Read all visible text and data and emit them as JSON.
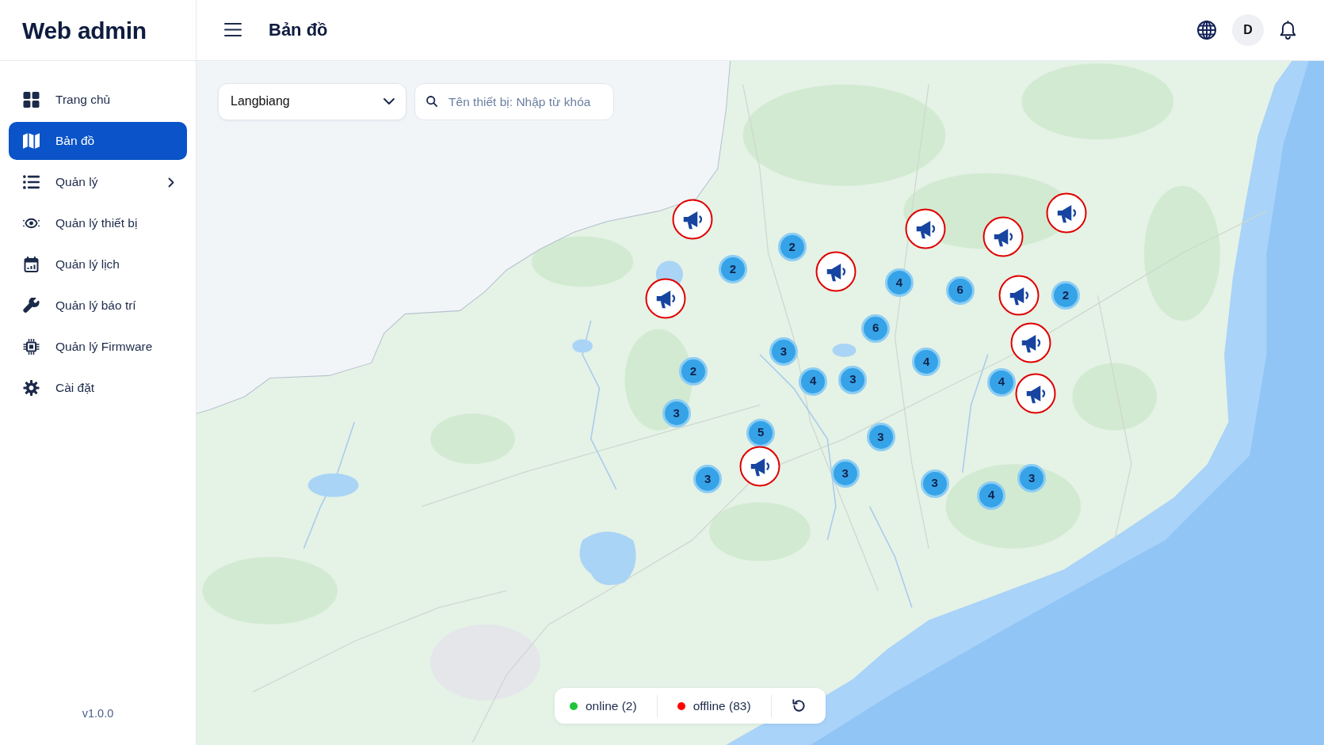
{
  "sidebar": {
    "title": "Web admin",
    "items": [
      {
        "label": "Trang chủ",
        "selected": false,
        "has_submenu": false
      },
      {
        "label": "Bản đồ",
        "selected": true,
        "has_submenu": false
      },
      {
        "label": "Quản lý",
        "selected": false,
        "has_submenu": true
      },
      {
        "label": "Quản lý thiết bị",
        "selected": false,
        "has_submenu": false
      },
      {
        "label": "Quản lý lịch",
        "selected": false,
        "has_submenu": false
      },
      {
        "label": "Quản lý báo trí",
        "selected": false,
        "has_submenu": false
      },
      {
        "label": "Quản lý Firmware",
        "selected": false,
        "has_submenu": false
      },
      {
        "label": "Cài đặt",
        "selected": false,
        "has_submenu": false
      }
    ],
    "version": "v1.0.0"
  },
  "header": {
    "title": "Bản đồ",
    "avatar_initial": "D"
  },
  "filters": {
    "region": "Langbiang",
    "search_placeholder": "Tên thiết bị: Nhập từ khóa"
  },
  "markers": [
    {
      "kind": "device",
      "online": false
    },
    {
      "kind": "device",
      "online": false
    },
    {
      "kind": "device",
      "online": false
    },
    {
      "kind": "device",
      "online": false
    },
    {
      "kind": "cluster",
      "count": "2"
    },
    {
      "kind": "cluster",
      "count": "2"
    },
    {
      "kind": "device",
      "online": false
    },
    {
      "kind": "cluster",
      "count": "4"
    },
    {
      "kind": "cluster",
      "count": "6"
    },
    {
      "kind": "device",
      "online": false
    },
    {
      "kind": "cluster",
      "count": "2"
    },
    {
      "kind": "device",
      "online": false
    },
    {
      "kind": "cluster",
      "count": "6"
    },
    {
      "kind": "device",
      "online": false
    },
    {
      "kind": "cluster",
      "count": "3"
    },
    {
      "kind": "cluster",
      "count": "4"
    },
    {
      "kind": "cluster",
      "count": "2"
    },
    {
      "kind": "cluster",
      "count": "4"
    },
    {
      "kind": "cluster",
      "count": "3"
    },
    {
      "kind": "cluster",
      "count": "4"
    },
    {
      "kind": "device",
      "online": false
    },
    {
      "kind": "cluster",
      "count": "3"
    },
    {
      "kind": "cluster",
      "count": "5"
    },
    {
      "kind": "cluster",
      "count": "3"
    },
    {
      "kind": "device",
      "online": false
    },
    {
      "kind": "cluster",
      "count": "3"
    },
    {
      "kind": "cluster",
      "count": "3"
    },
    {
      "kind": "cluster",
      "count": "3"
    },
    {
      "kind": "cluster",
      "count": "3"
    },
    {
      "kind": "cluster",
      "count": "4"
    }
  ],
  "legend": [
    {
      "label": "online (2)",
      "color": "#22c33a"
    },
    {
      "label": "offline (83)",
      "color": "#ff0000"
    }
  ]
}
